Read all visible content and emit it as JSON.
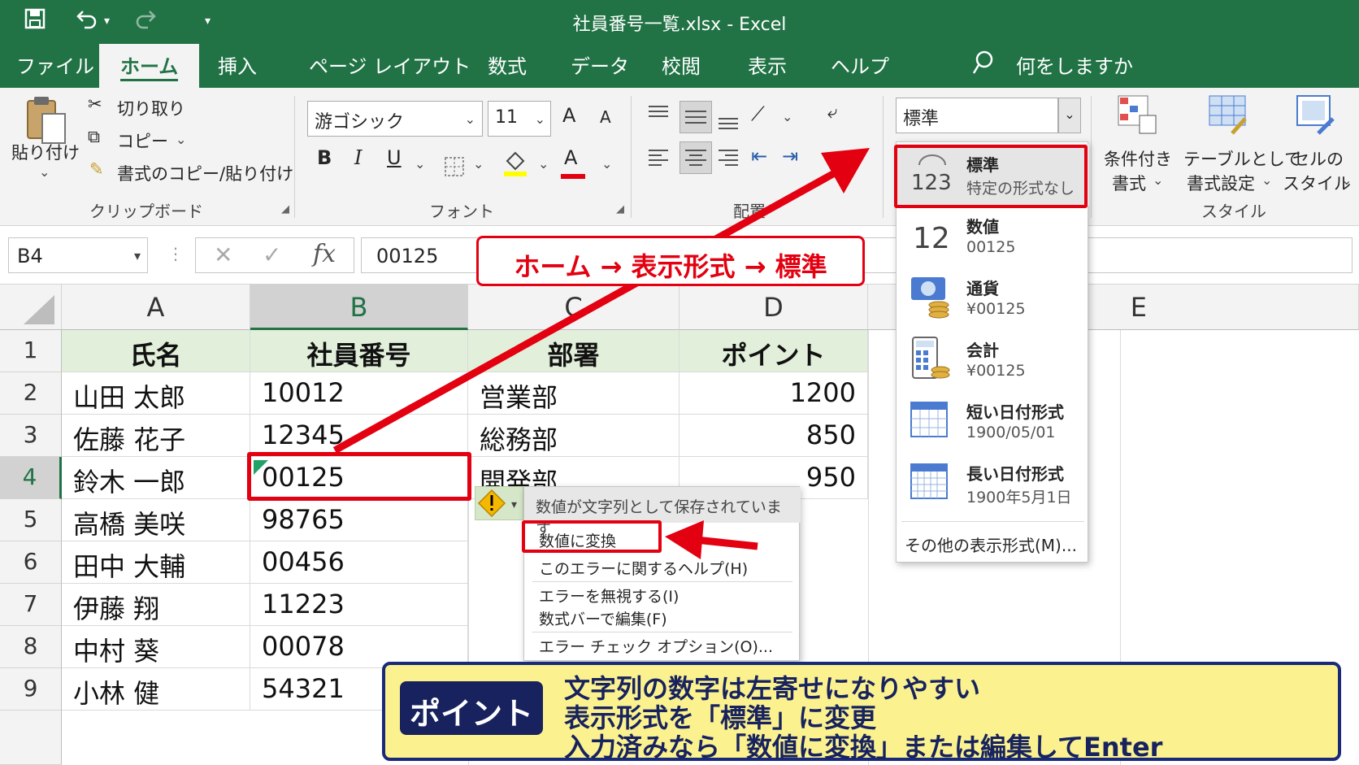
{
  "window": {
    "title": "社員番号一覧.xlsx  -  Excel"
  },
  "quick_access": {
    "save_icon": "save-icon",
    "undo_icon": "undo-icon",
    "redo_icon": "redo-icon",
    "customize_icon": "customize-icon"
  },
  "tabs": [
    "ファイル",
    "ホーム",
    "挿入",
    "ページ レイアウト",
    "数式",
    "データ",
    "校閲",
    "表示",
    "ヘルプ"
  ],
  "active_tab": "ホーム",
  "tellme": {
    "placeholder": "何をしますか"
  },
  "ribbon": {
    "clipboard": {
      "paste": "貼り付け",
      "cut": "切り取り",
      "copy": "コピー",
      "format_painter": "書式のコピー/貼り付け",
      "label": "クリップボード"
    },
    "font": {
      "name": "游ゴシック",
      "size": "11",
      "grow": "A",
      "shrink": "A",
      "bold": "B",
      "italic": "I",
      "underline": "U",
      "font_color_letter": "A",
      "label": "フォント"
    },
    "alignment": {
      "label": "配置"
    },
    "number": {
      "format": "標準"
    },
    "styles": {
      "conditional_line1": "条件付き",
      "conditional_line2": "書式",
      "table_line1": "テーブルとして",
      "table_line2": "書式設定",
      "cell_line1": "セルの",
      "cell_line2": "スタイル",
      "label": "スタイル"
    }
  },
  "formula_bar": {
    "name_box": "B4",
    "cancel": "✕",
    "enter": "✓",
    "fx": "fx",
    "value": "00125"
  },
  "columns": [
    "A",
    "B",
    "C",
    "D",
    "E"
  ],
  "rows": [
    "1",
    "2",
    "3",
    "4",
    "5",
    "6",
    "7",
    "8",
    "9"
  ],
  "table": {
    "headers": [
      "氏名",
      "社員番号",
      "部署",
      "ポイント"
    ],
    "data": [
      [
        "山田 太郎",
        "10012",
        "営業部",
        "1200"
      ],
      [
        "佐藤 花子",
        "12345",
        "総務部",
        "850"
      ],
      [
        "鈴木 一郎",
        "00125",
        "開発部",
        "950"
      ],
      [
        "高橋 美咲",
        "98765",
        "",
        ""
      ],
      [
        "田中 大輔",
        "00456",
        "",
        ""
      ],
      [
        "伊藤 翔",
        "11223",
        "",
        ""
      ],
      [
        "中村 葵",
        "00078",
        "",
        ""
      ],
      [
        "小林 健",
        "54321",
        "",
        ""
      ]
    ]
  },
  "number_format_menu": {
    "items": [
      {
        "icon": "general-format-icon",
        "glyph": "123",
        "name": "標準",
        "sample": "特定の形式なし"
      },
      {
        "icon": "number-format-icon",
        "glyph": "12",
        "name": "数値",
        "sample": "00125"
      },
      {
        "icon": "currency-format-icon",
        "name": "通貨",
        "sample": "¥00125"
      },
      {
        "icon": "accounting-format-icon",
        "name": "会計",
        "sample": "¥00125"
      },
      {
        "icon": "short-date-icon",
        "name": "短い日付形式",
        "sample": "1900/05/01"
      },
      {
        "icon": "long-date-icon",
        "name": "長い日付形式",
        "sample": "1900年5月1日"
      }
    ],
    "more": "その他の表示形式(M)..."
  },
  "error_menu": {
    "header": "数値が文字列として保存されています",
    "items": [
      "数値に変換",
      "このエラーに関するヘルプ(H)",
      "エラーを無視する(I)",
      "数式バーで編集(F)",
      "エラー チェック オプション(O)..."
    ]
  },
  "annotations": {
    "instruction": "ホーム → 表示形式 → 標準",
    "point_label": "ポイント",
    "points": [
      "文字列の数字は左寄せになりやすい",
      "表示形式を「標準」に変更",
      "入力済みなら「数値に変換」または編集してEnter"
    ]
  },
  "colors": {
    "excel_green": "#217346",
    "highlight_red": "#e30010",
    "point_yellow": "#fbf28f",
    "point_navy": "#17225e",
    "header_fill": "#e2efda"
  }
}
